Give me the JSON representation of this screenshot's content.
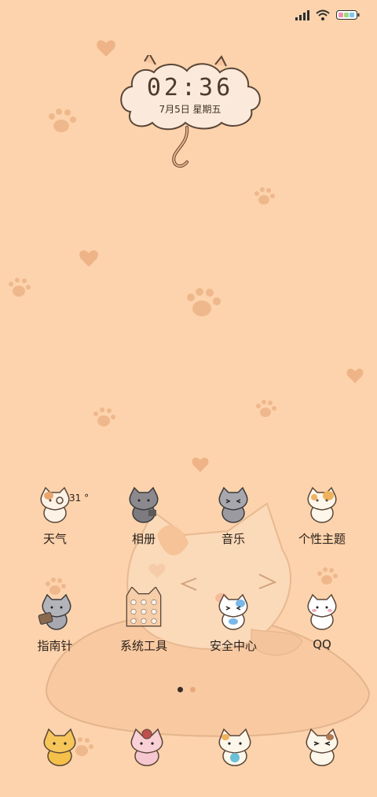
{
  "status_bar": {
    "signal_icon": "signal-bars-icon",
    "wifi_icon": "wifi-icon",
    "battery_icon": "battery-icon"
  },
  "clock": {
    "time": "02:36",
    "date": "7月5日 星期五"
  },
  "weather": {
    "temperature": "31 °"
  },
  "apps": [
    {
      "label": "天气"
    },
    {
      "label": "相册"
    },
    {
      "label": "音乐"
    },
    {
      "label": "个性主题"
    },
    {
      "label": "指南针"
    },
    {
      "label": "系统工具"
    },
    {
      "label": "安全中心"
    },
    {
      "label": "QQ"
    }
  ],
  "page_indicator": {
    "pages": 2,
    "current": 1
  },
  "colors": {
    "background": "#fcd3ac",
    "paw_print": "#f0b78a",
    "text": "#2b211b"
  }
}
